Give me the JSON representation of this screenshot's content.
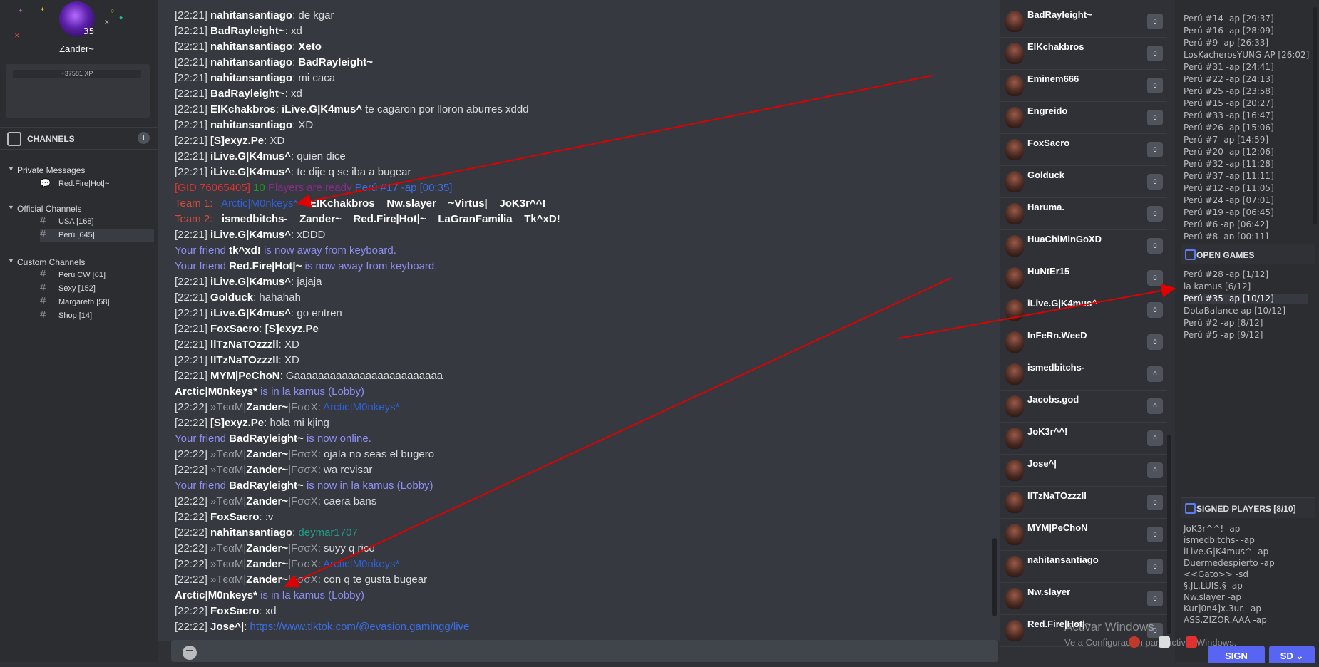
{
  "profile": {
    "level": "35",
    "username": "Zander~",
    "xp": "+37581 XP"
  },
  "channels": {
    "title": "CHANNELS",
    "add_icon": "plus",
    "groups": [
      {
        "title": "Private Messages",
        "items": [
          {
            "name": "Red.Fire|Hot|~"
          }
        ]
      },
      {
        "title": "Official Channels",
        "items": [
          {
            "name": "USA [168]"
          },
          {
            "name": "Perú [645]"
          }
        ]
      },
      {
        "title": "Custom Channels",
        "items": [
          {
            "name": "Perú CW [61]"
          },
          {
            "name": "Sexy [152]"
          },
          {
            "name": "Margareth [58]"
          },
          {
            "name": "Shop [14]"
          }
        ]
      }
    ]
  },
  "chat": {
    "messages": [
      {
        "time": "[22:21]",
        "user": "nahitansantiago",
        "text": "de kgar"
      },
      {
        "time": "[22:21]",
        "user": "BadRayleight~",
        "text": "xd"
      },
      {
        "time": "[22:21]",
        "user": "nahitansantiago",
        "text": "Xeto"
      },
      {
        "time": "[22:21]",
        "user": "nahitansantiago",
        "text": "BadRayleight~"
      },
      {
        "time": "[22:21]",
        "user": "nahitansantiago",
        "text": "mi caca"
      },
      {
        "time": "[22:21]",
        "user": "BadRayleight~",
        "text": "xd"
      },
      {
        "time": "[22:21]",
        "user": "ElKchakbros",
        "mention": "iLive.G|K4mus^",
        "text": "te cagaron por lloron aburres xddd"
      },
      {
        "time": "[22:21]",
        "user": "nahitansantiago",
        "text": "XD"
      },
      {
        "time": "[22:21]",
        "user": "[S]exyz.Pe",
        "text": "XD"
      },
      {
        "time": "[22:21]",
        "user": "iLive.G|K4mus^",
        "text": "quien dice"
      },
      {
        "time": "[22:21]",
        "user": "iLive.G|K4mus^",
        "text": "te dije q se iba a bugear"
      },
      {
        "gid": "[GID 76065405]",
        "count": "10",
        "label": "Players are ready",
        "game": "Perú #17 -ap [00:35]"
      },
      {
        "team": "Team 1:",
        "players": [
          "Arctic|M0nkeys*",
          "ElKchakbros",
          "Nw.slayer",
          "~Virtus|",
          "JoK3r^^!"
        ]
      },
      {
        "team": "Team 2:",
        "players": [
          "ismedbitchs-",
          "Zander~",
          "Red.Fire|Hot|~",
          "LaGranFamilia",
          "Tk^xD!"
        ]
      },
      {
        "time": "[22:21]",
        "user": "iLive.G|K4mus^",
        "text": "xDDD"
      },
      {
        "prefix": "Your friend",
        "user": "tk^xd!",
        "status": "is now away from keyboard."
      },
      {
        "prefix": "Your friend",
        "user": "Red.Fire|Hot|~",
        "status": "is now away from keyboard."
      },
      {
        "time": "[22:21]",
        "user": "iLive.G|K4mus^",
        "text": "jajaja"
      },
      {
        "time": "[22:21]",
        "user": "Golduck",
        "text": "hahahah"
      },
      {
        "time": "[22:21]",
        "user": "iLive.G|K4mus^",
        "text": "go entren"
      },
      {
        "time": "[22:21]",
        "user": "FoxSacro",
        "bold_text": "[S]exyz.Pe"
      },
      {
        "time": "[22:21]",
        "user": "llTzNaTOzzzll",
        "text": "XD"
      },
      {
        "time": "[22:21]",
        "user": "llTzNaTOzzzll",
        "text": "XD"
      },
      {
        "time": "[22:21]",
        "user": "MYM|PeChoN",
        "text": "Gaaaaaaaaaaaaaaaaaaaaaaaaa"
      },
      {
        "user": "Arctic|M0nkeys*",
        "status": "is in la kamus (Lobby)"
      },
      {
        "time": "[22:22]",
        "clan": "»TєαM|",
        "user": "Zander~",
        "clan2": "|FσσX",
        "colored": "Arctic|M0nkeys*"
      },
      {
        "time": "[22:22]",
        "user": "[S]exyz.Pe",
        "text": "hola mi kjing"
      },
      {
        "prefix": "Your friend",
        "user": "BadRayleight~",
        "status": "is now online."
      },
      {
        "time": "[22:22]",
        "clan": "»TєαM|",
        "user": "Zander~",
        "clan2": "|FσσX",
        "text": "ojala no seas el bugero"
      },
      {
        "time": "[22:22]",
        "clan": "»TєαM|",
        "user": "Zander~",
        "clan2": "|FσσX",
        "text": "wa revisar"
      },
      {
        "prefix": "Your friend",
        "user": "BadRayleight~",
        "status": "is now in la kamus (Lobby)"
      },
      {
        "time": "[22:22]",
        "clan": "»TєαM|",
        "user": "Zander~",
        "clan2": "|FσσX",
        "text": "caera bans"
      },
      {
        "time": "[22:22]",
        "user": "FoxSacro",
        "text": ":v"
      },
      {
        "time": "[22:22]",
        "user": "nahitansantiago",
        "teal": "deymar1707"
      },
      {
        "time": "[22:22]",
        "clan": "»TєαM|",
        "user": "Zander~",
        "clan2": "|FσσX",
        "text": "suyy q rico"
      },
      {
        "time": "[22:22]",
        "clan": "»TєαM|",
        "user": "Zander~",
        "clan2": "|FσσX",
        "colored": "Arctic|M0nkeys*"
      },
      {
        "time": "[22:22]",
        "clan": "»TєαM|",
        "user": "Zander~",
        "clan2": "|FσσX",
        "text": "con q te gusta bugear"
      },
      {
        "user": "Arctic|M0nkeys*",
        "status": "is in la kamus (Lobby)"
      },
      {
        "time": "[22:22]",
        "user": "FoxSacro",
        "text": "xd"
      },
      {
        "time": "[22:22]",
        "user": "Jose^|",
        "link": "https://www.tiktok.com/@evasion.gamingg/live"
      }
    ]
  },
  "users": [
    {
      "name": "BadRayleight~",
      "badge": "0"
    },
    {
      "name": "ElKchakbros",
      "badge": "0"
    },
    {
      "name": "Eminem666",
      "badge": "0"
    },
    {
      "name": "Engreido",
      "badge": "0"
    },
    {
      "name": "FoxSacro",
      "badge": "0"
    },
    {
      "name": "Golduck",
      "badge": "0"
    },
    {
      "name": "Haruma.",
      "badge": "0"
    },
    {
      "name": "HuaChiMinGoXD",
      "badge": "0"
    },
    {
      "name": "HuNtEr15",
      "badge": "0"
    },
    {
      "name": "iLive.G|K4mus^",
      "badge": "0"
    },
    {
      "name": "InFeRn.WeeD",
      "badge": "0"
    },
    {
      "name": "ismedbitchs-",
      "badge": "0"
    },
    {
      "name": "Jacobs.god",
      "badge": "0"
    },
    {
      "name": "JoK3r^^!",
      "badge": "0"
    },
    {
      "name": "Jose^|",
      "badge": "0"
    },
    {
      "name": "llTzNaTOzzzll",
      "badge": "0"
    },
    {
      "name": "MYM|PeChoN",
      "badge": "0"
    },
    {
      "name": "nahitansantiago",
      "badge": "0"
    },
    {
      "name": "Nw.slayer",
      "badge": "0"
    },
    {
      "name": "Red.Fire|Hot|~",
      "badge": "0"
    }
  ],
  "games_in_progress": [
    "Perú #14 -ap [29:37]",
    "Perú #16 -ap [28:09]",
    "Perú #9 -ap [26:33]",
    "LosKacherosYUNG AP [26:02]",
    "Perú #31 -ap [24:41]",
    "Perú #22 -ap [24:13]",
    "Perú #25 -ap [23:58]",
    "Perú #15 -ap [20:27]",
    "Perú #33 -ap [16:47]",
    "Perú #26 -ap [15:06]",
    "Perú #7 -ap [14:59]",
    "Perú #20 -ap [12:06]",
    "Perú #32 -ap [11:28]",
    "Perú #37 -ap [11:11]",
    "Perú #12 -ap [11:05]",
    "Perú #24 -ap [07:01]",
    "Perú #19 -ap [06:45]",
    "Perú #6 -ap [06:42]",
    "Perú #8 -ap [00:11]"
  ],
  "open_games": {
    "title": "OPEN GAMES",
    "items": [
      "Perú #28 -ap [1/12]",
      "la kamus [6/12]",
      "Perú #35 -ap [10/12]",
      "DotaBalance ap [10/12]",
      "Perú #2 -ap [8/12]",
      "Perú #5 -ap [9/12]"
    ],
    "selected": "Perú #35 -ap [10/12]"
  },
  "signed_players": {
    "title": "SIGNED PLAYERS [8/10]",
    "items": [
      "JoK3r^^! -ap",
      "ismedbitchs- -ap",
      "iLive.G|K4mus^ -ap",
      "Duermedespierto -ap",
      "<<Gato>> -sd",
      "§.JL.LUIS.§ -ap",
      "Nw.slayer -ap",
      "Kur]0n4]x.3ur. -ap",
      "ASS.ZIZOR.AAA -ap"
    ]
  },
  "buttons": {
    "sign": "SIGN",
    "sd": "SD"
  },
  "watermark": {
    "line1": "Activar Windows",
    "line2": "Ve a Configuración para activar Windows."
  },
  "colors": {
    "annotation_arrows": "#e00000",
    "accent": "#5865f2"
  }
}
